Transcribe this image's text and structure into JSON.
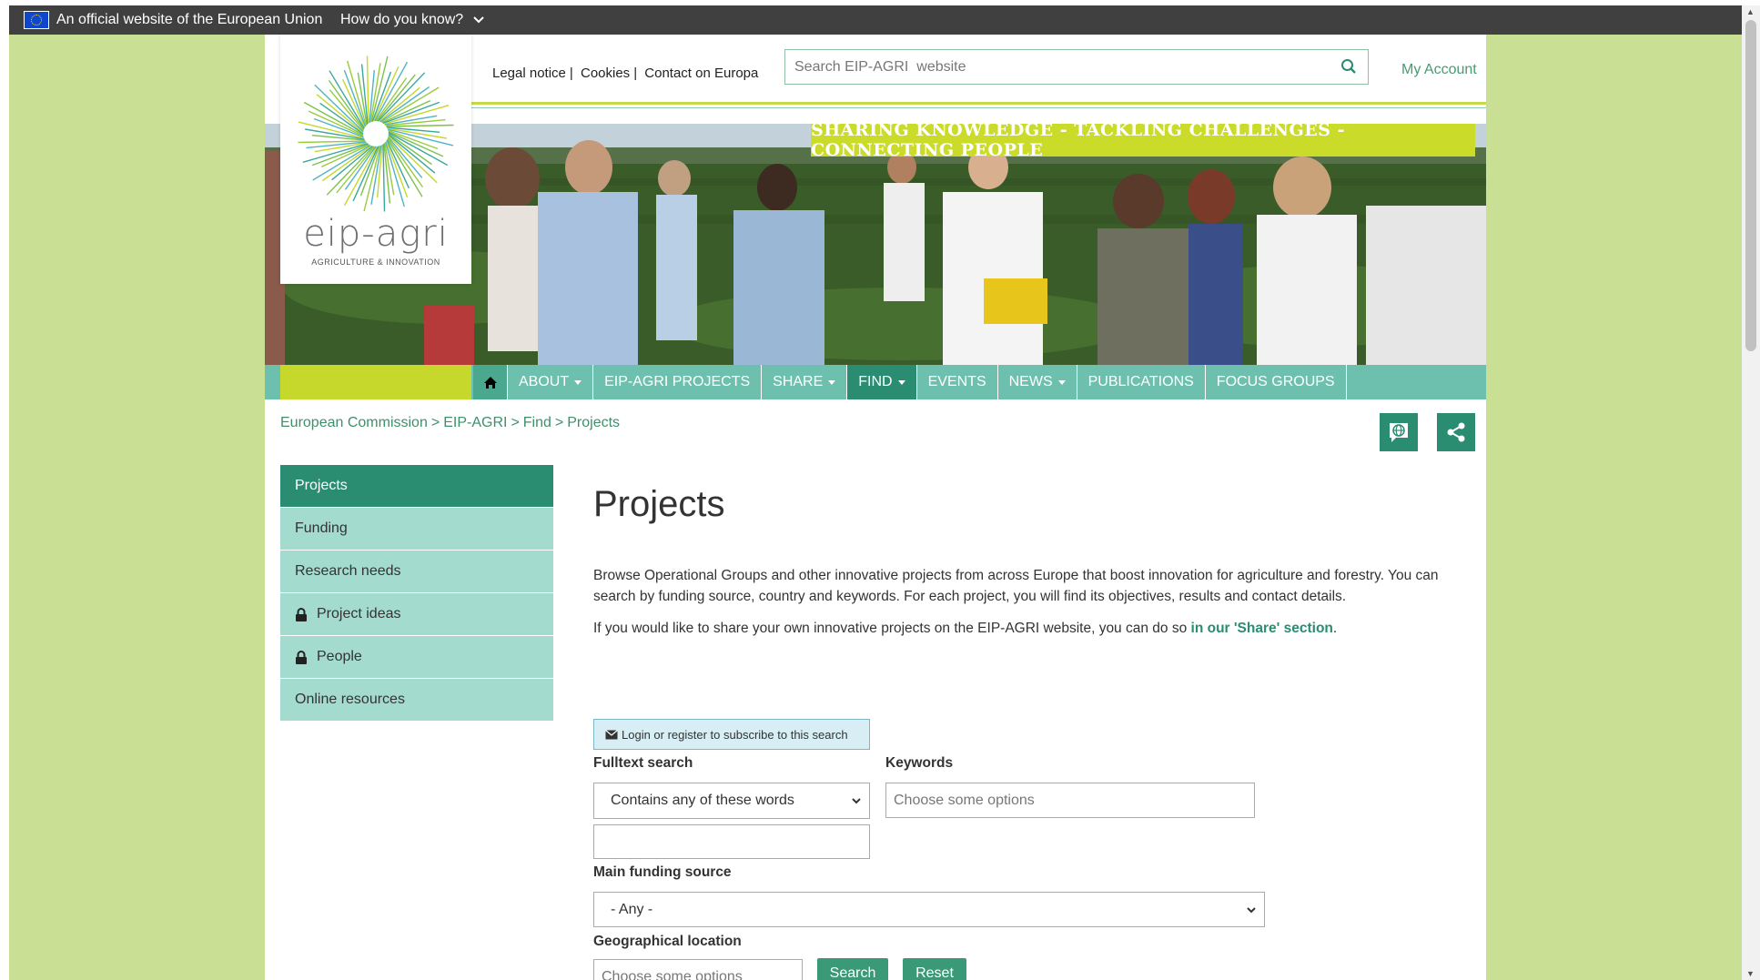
{
  "eu_bar": {
    "official_text": "An official website of the European Union",
    "how_text": "How do you know?"
  },
  "logo": {
    "name": "eip-agri",
    "subtitle": "AGRICULTURE & INNOVATION"
  },
  "top_links": [
    "Legal notice",
    "Cookies",
    "Contact on Europa"
  ],
  "search": {
    "placeholder": "Search EIP-AGRI  website"
  },
  "my_account": "My Account",
  "banner": {
    "tagline": "SHARING KNOWLEDGE - TACKLING CHALLENGES - CONNECTING PEOPLE"
  },
  "nav": {
    "items": [
      {
        "label": "ABOUT",
        "dropdown": true
      },
      {
        "label": "EIP-AGRI PROJECTS",
        "dropdown": false
      },
      {
        "label": "SHARE",
        "dropdown": true
      },
      {
        "label": "FIND",
        "dropdown": true,
        "active": true
      },
      {
        "label": "EVENTS",
        "dropdown": false
      },
      {
        "label": "NEWS",
        "dropdown": true
      },
      {
        "label": "PUBLICATIONS",
        "dropdown": false
      },
      {
        "label": "FOCUS GROUPS",
        "dropdown": false
      }
    ]
  },
  "breadcrumb": [
    "European Commission",
    "EIP-AGRI",
    "Find",
    "Projects"
  ],
  "sidebar": {
    "items": [
      {
        "label": "Projects",
        "active": true,
        "locked": false
      },
      {
        "label": "Funding",
        "active": false,
        "locked": false
      },
      {
        "label": "Research needs",
        "active": false,
        "locked": false
      },
      {
        "label": "Project ideas",
        "active": false,
        "locked": true
      },
      {
        "label": "People",
        "active": false,
        "locked": true
      },
      {
        "label": "Online resources",
        "active": false,
        "locked": false
      }
    ]
  },
  "main": {
    "title": "Projects",
    "intro_line1": "Browse Operational Groups and other innovative projects from across Europe that boost innovation for agriculture and forestry. You can",
    "intro_line2": "search by funding source, country and keywords. For each project, you will find its objectives, results and contact details.",
    "share_text": "If you would like to share your own innovative projects on the EIP-AGRI website, you can do so ",
    "share_link": "in our 'Share' section",
    "share_end": ".",
    "subscribe_label": "Login or register to subscribe to this search"
  },
  "form": {
    "fulltext_label": "Fulltext search",
    "fulltext_mode": "Contains any of these words",
    "fulltext_value": "",
    "keywords_label": "Keywords",
    "keywords_placeholder": "Choose some options",
    "funding_label": "Main funding source",
    "funding_value": "- Any -",
    "geo_label": "Geographical location",
    "geo_placeholder": "Choose some options",
    "search_button": "Search",
    "reset_button": "Reset"
  },
  "colors": {
    "page_bg": "#c9df93",
    "brand_green": "#2a8c70",
    "nav_teal": "#6dbfae",
    "lime": "#c6d82b",
    "menu_light": "#a3dccf"
  }
}
